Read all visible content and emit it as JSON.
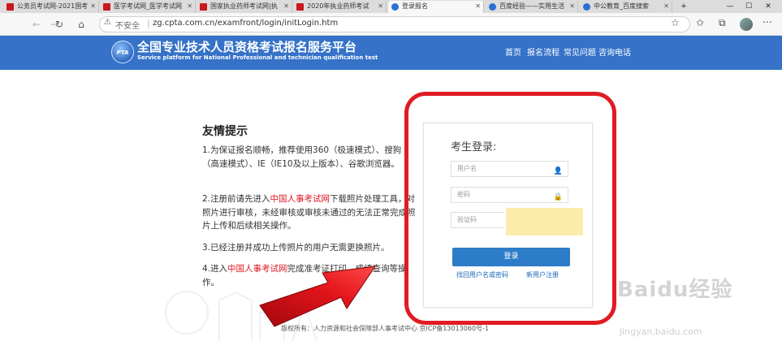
{
  "browser": {
    "tabs": [
      {
        "label": "公务员考试网-2021国考",
        "active": false,
        "favicon": "red-logo"
      },
      {
        "label": "医学考试网_医学考试网",
        "active": false,
        "favicon": "red-logo"
      },
      {
        "label": "国家执业药师考试网|执",
        "active": false,
        "favicon": "red-logo"
      },
      {
        "label": "2020年执业药师考试",
        "active": false,
        "favicon": "red-logo"
      },
      {
        "label": "登录报名",
        "active": true,
        "favicon": "globe"
      },
      {
        "label": "百度经验——实用生活",
        "active": false,
        "favicon": "paw"
      },
      {
        "label": "中公教育_百度搜索",
        "active": false,
        "favicon": "paw"
      }
    ],
    "new_tab": "+",
    "window_buttons": [
      "—",
      "☐",
      "✕"
    ],
    "security_label": "不安全",
    "url": "zg.cpta.com.cn/examfront/login/initLogin.htm"
  },
  "site": {
    "title": "全国专业技术人员资格考试报名服务平台",
    "subtitle": "Service platform for National Professional and technician qualification test",
    "logo_text": "PTA",
    "nav": [
      "首页",
      "报名流程",
      "常见问题",
      "咨询电话"
    ]
  },
  "tips": {
    "title": "友情提示",
    "items": [
      {
        "before": "1.为保证报名顺畅，推荐使用360（极速模式）、搜狗（高速模式）、IE（IE10及以上版本）、谷歌浏览器。",
        "link": "",
        "after": ""
      },
      {
        "before": "2.注册前请先进入",
        "link": "中国人事考试网",
        "after": "下载照片处理工具，对照片进行审核，未经审核或审核未通过的无法正常完成照片上传和后续相关操作。"
      },
      {
        "before": "3.已经注册并成功上传照片的用户无需更换照片。",
        "link": "",
        "after": ""
      },
      {
        "before": "4.进入",
        "link": "中国人事考试网",
        "after": "完成准考证打印、成绩查询等操作。"
      }
    ]
  },
  "login": {
    "title": "考生登录:",
    "username_placeholder": "用户名",
    "password_placeholder": "密码",
    "captcha_placeholder": "验证码",
    "submit_label": "登录",
    "forgot_link": "找回用户名或密码",
    "register_link": "新用户注册"
  },
  "footer": "版权所有：人力资源和社会保障部人事考试中心 京ICP备13013060号-1",
  "watermark": {
    "main": "Baidu经验",
    "sub": "jingyan.baidu.com"
  },
  "colors": {
    "header_blue": "#3572c8",
    "highlight_red": "#e01b24",
    "link_red": "#e0141e",
    "button_blue": "#2d7cc8"
  }
}
